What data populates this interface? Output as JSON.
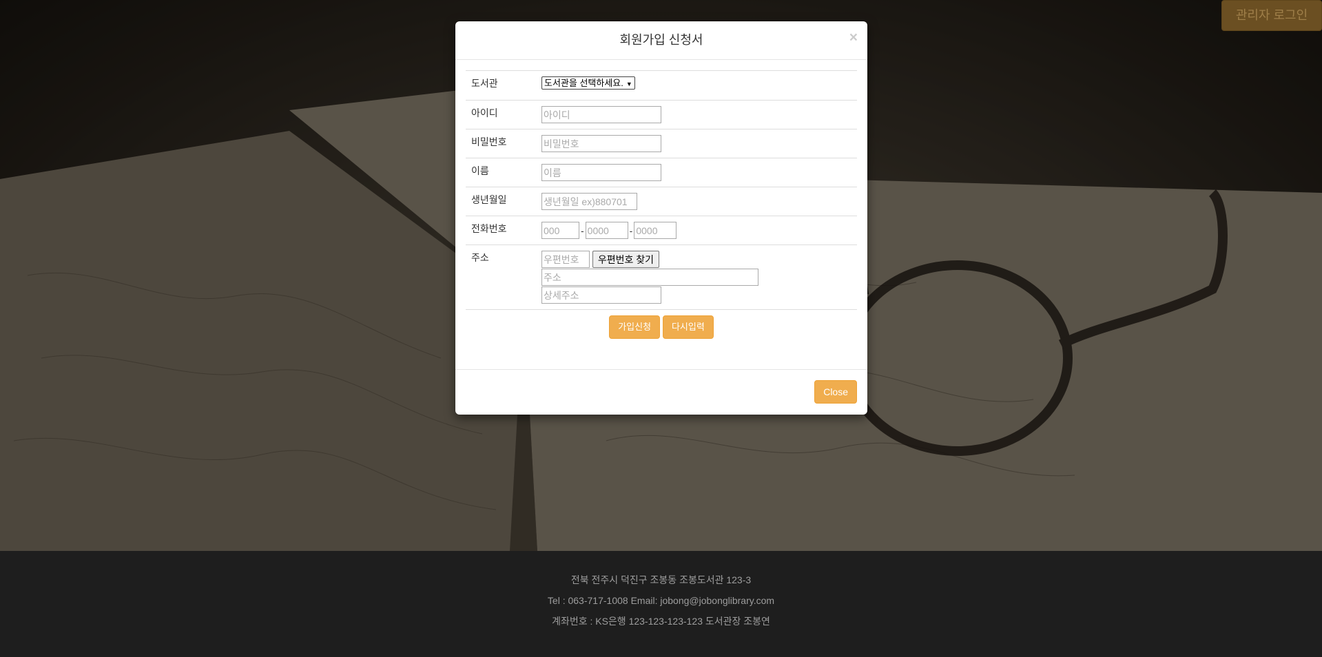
{
  "admin_login": "관리자 로그인",
  "modal": {
    "title": "회원가입 신청서",
    "close_x": "×",
    "fields": {
      "library_label": "도서관",
      "library_selected": "도서관을 선택하세요.",
      "id_label": "아이디",
      "id_placeholder": "아이디",
      "password_label": "비밀번호",
      "password_placeholder": "비밀번호",
      "name_label": "이름",
      "name_placeholder": "이름",
      "birth_label": "생년월일",
      "birth_placeholder": "생년월일 ex)880701",
      "phone_label": "전화번호",
      "phone1_placeholder": "000",
      "phone2_placeholder": "0000",
      "phone3_placeholder": "0000",
      "phone_separator": "-",
      "address_label": "주소",
      "postcode_placeholder": "우편번호",
      "postcode_button": "우편번호 찾기",
      "address_placeholder": "주소",
      "address_detail_placeholder": "상세주소"
    },
    "submit_button": "가입신청",
    "reset_button": "다시입력",
    "close_button": "Close"
  },
  "footer": {
    "address": "전북 전주시 덕진구 조봉동 조봉도서관 123-3",
    "contact": "Tel : 063-717-1008 Email: jobong@jobonglibrary.com",
    "account": "계좌번호 : KS은행 123-123-123-123 도서관장 조봉연"
  },
  "colors": {
    "accent": "#f0ad4e",
    "footer_bg": "#1e1e1e",
    "admin_button": "#6b4f22"
  }
}
